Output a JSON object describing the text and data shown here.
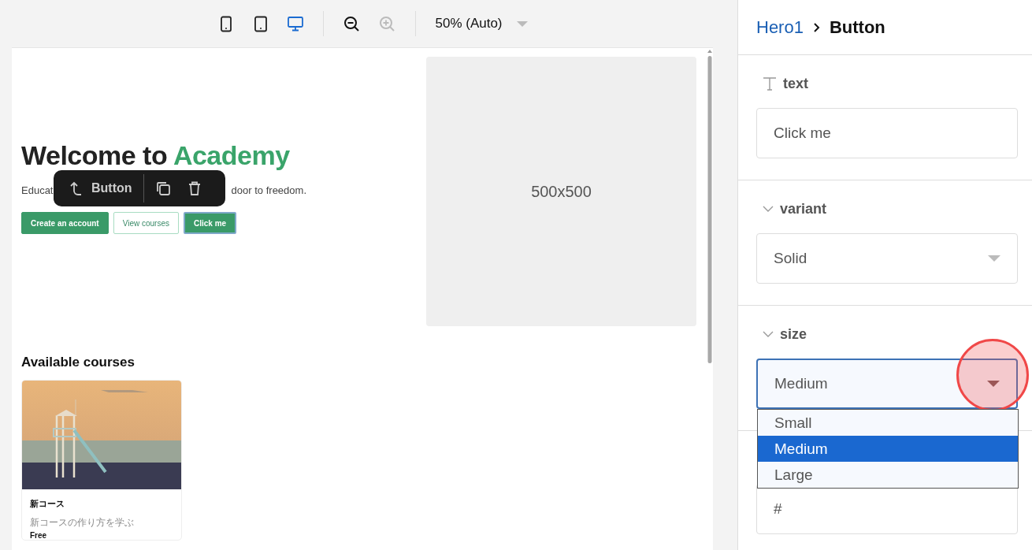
{
  "toolbar": {
    "devices": [
      {
        "kind": "phone",
        "selected": false
      },
      {
        "kind": "tablet",
        "selected": false
      },
      {
        "kind": "desktop",
        "selected": true
      }
    ],
    "zoom_out": {
      "disabled": false
    },
    "zoom_in": {
      "disabled": true
    },
    "zoom_select": {
      "value": "50% (Auto)"
    }
  },
  "canvas": {
    "hero": {
      "heading": "Welcome to",
      "heading_accent": "Academy",
      "subtitle_parts": [
        "Educat",
        "door to freedom."
      ],
      "buttons": [
        {
          "label": "Create an account",
          "kind": "solid",
          "selected": false
        },
        {
          "label": "View courses",
          "kind": "outline",
          "selected": false
        },
        {
          "label": "Click me",
          "kind": "solid",
          "selected": true
        }
      ],
      "image_placeholder": "500x500"
    },
    "element_toolbar": {
      "label": "Button"
    },
    "courses": {
      "title": "Available courses",
      "cards": [
        {
          "kind": "picture",
          "title": "新コース",
          "description": "新コースの作り方を学ぶ",
          "price": "Free"
        }
      ]
    }
  },
  "panel": {
    "breadcrumb": [
      {
        "label": "Hero1",
        "kind": "link"
      },
      {
        "label": "Button",
        "kind": "current"
      }
    ],
    "properties": [
      {
        "kind": "text",
        "label": "text",
        "value": "Click me"
      },
      {
        "kind": "select",
        "label": "variant",
        "value": "Solid",
        "expanded": false
      },
      {
        "kind": "select",
        "label": "size",
        "value": "Medium",
        "expanded": true,
        "options": [
          {
            "label": "Small",
            "selected": false
          },
          {
            "label": "Medium",
            "selected": true
          },
          {
            "label": "Large",
            "selected": false
          }
        ]
      },
      {
        "kind": "text",
        "value": "#"
      }
    ]
  }
}
